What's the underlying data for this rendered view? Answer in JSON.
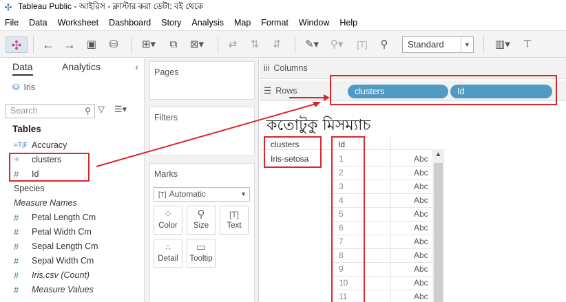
{
  "window": {
    "title": "Tableau Public - আইরিস - ক্লাস্টার করা ডেটা: বই থেকে"
  },
  "menu": [
    "File",
    "Data",
    "Worksheet",
    "Dashboard",
    "Story",
    "Analysis",
    "Map",
    "Format",
    "Window",
    "Help"
  ],
  "toolbar": {
    "view_size": "Standard"
  },
  "data_pane": {
    "tabs": [
      "Data",
      "Analytics"
    ],
    "source": "Iris",
    "search_placeholder": "Search",
    "tables_label": "Tables",
    "fields": [
      {
        "icon": "calc-text-icon",
        "glyph": "=T|F",
        "label": "Accuracy",
        "italic": false
      },
      {
        "icon": "cluster-icon",
        "glyph": "⚛",
        "label": "clusters",
        "italic": false
      },
      {
        "icon": "number-icon",
        "glyph": "#",
        "label": "Id",
        "italic": false
      },
      {
        "icon": "abc-icon",
        "glyph": "Abc",
        "label": "Species",
        "italic": false
      },
      {
        "icon": "abc-icon",
        "glyph": "Abc",
        "label": "Measure Names",
        "italic": true
      },
      {
        "icon": "number-icon",
        "glyph": "#",
        "label": "Petal Length Cm",
        "italic": false
      },
      {
        "icon": "number-icon",
        "glyph": "#",
        "label": "Petal Width Cm",
        "italic": false
      },
      {
        "icon": "number-icon",
        "glyph": "#",
        "label": "Sepal Length Cm",
        "italic": false
      },
      {
        "icon": "number-icon",
        "glyph": "#",
        "label": "Sepal Width Cm",
        "italic": false
      },
      {
        "icon": "number-icon",
        "glyph": "#",
        "label": "Iris.csv (Count)",
        "italic": true
      },
      {
        "icon": "number-icon",
        "glyph": "#",
        "label": "Measure Values",
        "italic": true
      }
    ]
  },
  "shelves": {
    "pages": "Pages",
    "filters": "Filters",
    "marks": "Marks",
    "mark_type": "Automatic",
    "mark_buttons": [
      {
        "label": "Color",
        "icon": "color-icon"
      },
      {
        "label": "Size",
        "icon": "size-icon"
      },
      {
        "label": "Text",
        "icon": "text-icon"
      },
      {
        "label": "Detail",
        "icon": "detail-icon"
      },
      {
        "label": "Tooltip",
        "icon": "tooltip-icon"
      }
    ],
    "columns": "Columns",
    "rows": "Rows",
    "row_pills": [
      "clusters",
      "Id"
    ]
  },
  "view": {
    "title": "কতোটুকু মিসম্যাচ",
    "headers": [
      "clusters",
      "Id"
    ],
    "cluster_value": "Iris-setosa",
    "ids": [
      "1",
      "2",
      "3",
      "4",
      "5",
      "6",
      "7",
      "8",
      "9",
      "10",
      "11"
    ],
    "cell_text": "Abc"
  },
  "colors": {
    "pill": "#4f9bc4",
    "annotation": "#d9262c"
  }
}
